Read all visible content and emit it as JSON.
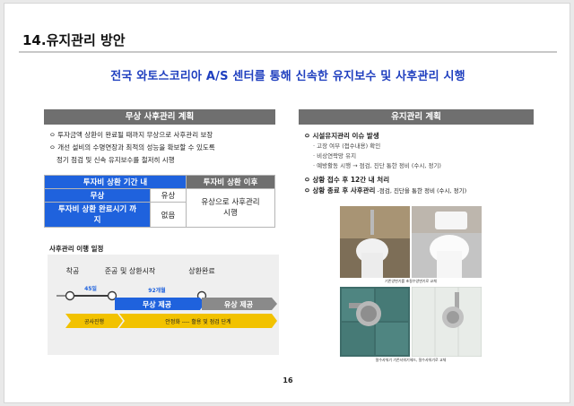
{
  "page": {
    "title": "14.유지관리 방안",
    "headline": "전국 와토스코리아 A/S 센터를 통해 신속한 유지보수 및 사후관리 시행",
    "page_number": "16"
  },
  "left": {
    "section_title": "무상 사후관리 계획",
    "bullets": [
      "ㅇ 투자금액 상환이 완료될 때까지 무상으로 사후관리 보장",
      "ㅇ 개선 설비의 수명연장과 최적의 성능을 확보할 수 있도록",
      "정기 점검 및 신속 유지보수를 철저히 시행"
    ],
    "table": {
      "header_left": "투자비 상환 기간 내",
      "header_right": "투자비 상환 이후",
      "row1_label": "무상",
      "row1_value": "유상",
      "row2_label": "투자비 상환 완료시기 까지",
      "row2_value": "없음",
      "merged_right": "유상으로 사후관리 시행"
    },
    "schedule": {
      "title": "사후관리 이행 일정",
      "milestones": [
        "착공",
        "준공 및 상환시작",
        "상환완료"
      ],
      "duration1": "45일",
      "duration2": "92개월",
      "bar_free": "무상 제공",
      "bar_paid": "유상 제공",
      "phase1": "공사진행",
      "phase2": "안정화 ---- 활용 및 점검 단계",
      "color_blue": "#1f62dd",
      "color_gray": "#8a8a8a",
      "color_yellow": "#f2c200"
    }
  },
  "right": {
    "section_title": "유지관리 계획",
    "item1": "ㅇ 시설유지관리 이슈 발생",
    "subitems": [
      "고장 여부 (접수내용) 확인",
      "비상연락망 유지",
      "예방활동 시행 → 점검, 진단 통한 정비 (수시, 정기)"
    ],
    "item2": "ㅇ 상황 접수 후 12간 내 처리",
    "item3_bold": "ㅇ 상황 종료 후 사후관리",
    "item3_rest": " -점검, 진단을 통한 정비 (수시, 정기)",
    "caption_top": "기존양변기를 초절수양변기로 교체",
    "caption_bottom": "절수샤워기 기존샤워기헤드, 절수샤워기로 교체"
  }
}
